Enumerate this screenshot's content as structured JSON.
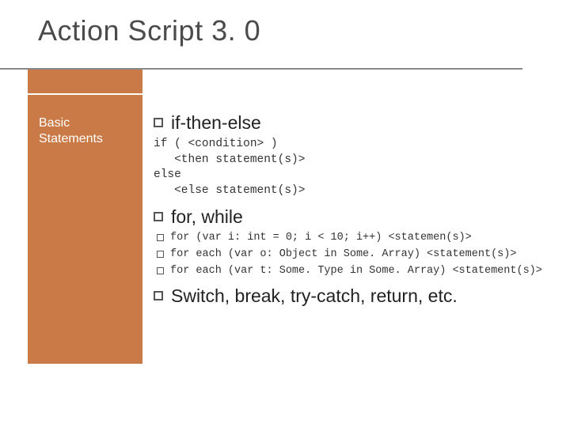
{
  "title": "Action Script 3. 0",
  "sidebar": {
    "line1": "Basic",
    "line2": "Statements"
  },
  "section1": {
    "heading": "if-then-else",
    "code": "if ( <condition> )\n   <then statement(s)>\nelse\n   <else statement(s)>"
  },
  "section2": {
    "heading": "for, while",
    "items": [
      "for (var i: int = 0; i < 10; i++) <statemen(s)>",
      "for each (var o: Object in Some. Array) <statement(s)>",
      "for each (var t: Some. Type in Some. Array) <statement(s)>"
    ]
  },
  "section3": {
    "heading": "Switch, break, try-catch, return,  etc."
  }
}
